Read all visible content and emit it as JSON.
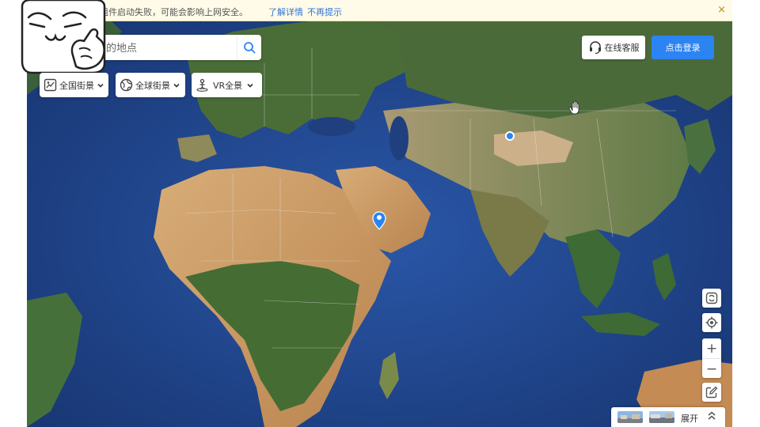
{
  "notice": {
    "message": "组件启动失败，可能会影响上网安全。",
    "details_link": "了解详情",
    "dismiss_link": "不再提示",
    "close_glyph": "×"
  },
  "search": {
    "placeholder": "的地点",
    "icon": "search-icon"
  },
  "views": [
    {
      "label": "全国街景",
      "icon": "street-view-icon"
    },
    {
      "label": "全球街景",
      "icon": "globe-icon"
    },
    {
      "label": "VR全景",
      "icon": "vr-person-icon"
    }
  ],
  "header": {
    "service_label": "在线客服",
    "service_icon": "headset-icon",
    "login_label": "点击登录"
  },
  "controls": {
    "zoom_in": "+",
    "zoom_out": "−",
    "icons": [
      "rotate-3d-icon",
      "locate-icon",
      "edit-icon"
    ]
  },
  "bottom_bar": {
    "expand_label": "展开",
    "chevron": "⌃",
    "thumbnails": [
      "street-thumbnail-1",
      "street-thumbnail-2"
    ]
  },
  "markers": [
    {
      "type": "pin",
      "color": "#2c84f3"
    },
    {
      "type": "dot",
      "color": "#2c84f3"
    }
  ],
  "colors": {
    "accent": "#2c84f3",
    "notice_bg": "#fffbe8",
    "ocean": "#1d3f86",
    "desert": "#c99a63",
    "forest": "#3f6a32"
  }
}
